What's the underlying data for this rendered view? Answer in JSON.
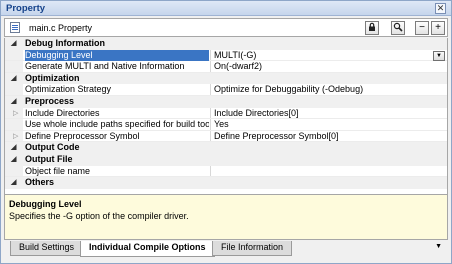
{
  "window": {
    "title": "Property"
  },
  "toolbar": {
    "file_label": "main.c Property"
  },
  "grid": {
    "rows": [
      {
        "type": "category",
        "name": "Debug Information"
      },
      {
        "type": "prop",
        "name": "Debugging Level",
        "value": "MULTI(-G)",
        "selected": true
      },
      {
        "type": "prop",
        "name": "Generate MULTI and Native Information",
        "value": "On(-dwarf2)"
      },
      {
        "type": "category",
        "name": "Optimization"
      },
      {
        "type": "prop",
        "name": "Optimization Strategy",
        "value": "Optimize for Debuggability (-Odebug)"
      },
      {
        "type": "category",
        "name": "Preprocess"
      },
      {
        "type": "prop",
        "name": "Include Directories",
        "value": "Include Directories[0]",
        "expandable": true
      },
      {
        "type": "prop",
        "name": "Use whole include paths specified for build tool",
        "value": "Yes"
      },
      {
        "type": "prop",
        "name": "Define Preprocessor Symbol",
        "value": "Define Preprocessor Symbol[0]",
        "expandable": true
      },
      {
        "type": "category",
        "name": "Output Code"
      },
      {
        "type": "category",
        "name": "Output File"
      },
      {
        "type": "prop",
        "name": "Object file name",
        "value": ""
      },
      {
        "type": "category",
        "name": "Others"
      }
    ]
  },
  "description": {
    "title": "Debugging Level",
    "text": "Specifies the -G option of the compiler driver."
  },
  "tabs": [
    {
      "label": "Build Settings",
      "active": false
    },
    {
      "label": "Individual Compile Options",
      "active": true
    },
    {
      "label": "File Information",
      "active": false
    }
  ]
}
